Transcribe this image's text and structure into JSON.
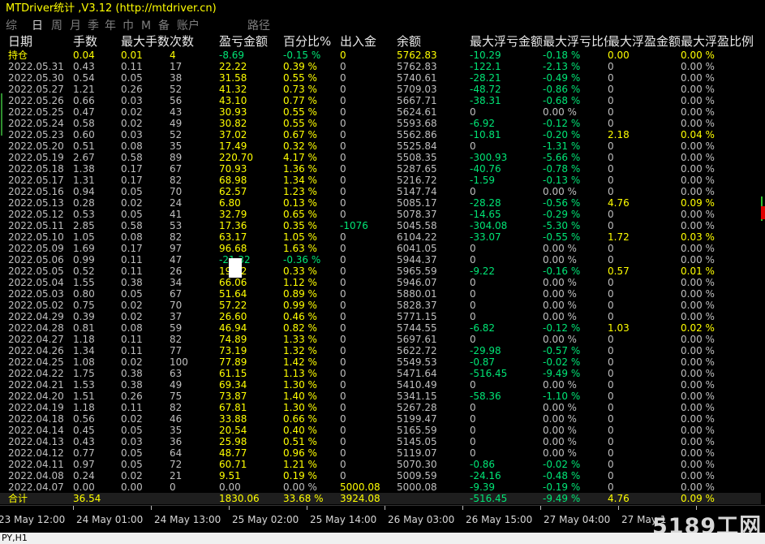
{
  "window": {
    "title": "MTDriver统计 ,V3.12 (http://mtdriver.cn)"
  },
  "tabs": {
    "items": [
      {
        "label": "综"
      },
      {
        "label": "日"
      },
      {
        "label": "周"
      },
      {
        "label": "月"
      },
      {
        "label": "季"
      },
      {
        "label": "年"
      },
      {
        "label": "巾"
      },
      {
        "label": "M"
      },
      {
        "label": "备"
      },
      {
        "label": "账户"
      }
    ],
    "path": "路径"
  },
  "table": {
    "headers": [
      "日期",
      "手数",
      "最大手数",
      "次数",
      "盈亏金额",
      "百分比%",
      "出入金",
      "余额",
      "最大浮亏金额",
      "最大浮亏比例",
      "最大浮盈金额",
      "最大浮盈比例"
    ],
    "holding": [
      "持仓",
      "0.04",
      "0.01",
      "4",
      "-8.69",
      "-0.15 %",
      "0",
      "5762.83",
      "-10.29",
      "-0.18 %",
      "0.00",
      "0.00 %"
    ],
    "rows": [
      [
        "2022.05.31",
        "0.43",
        "0.11",
        "17",
        "22.22",
        "0.39 %",
        "0",
        "5762.83",
        "-122.1",
        "-2.13 %",
        "0",
        "0.00 %"
      ],
      [
        "2022.05.30",
        "0.54",
        "0.05",
        "38",
        "31.58",
        "0.55 %",
        "0",
        "5740.61",
        "-28.21",
        "-0.49 %",
        "0",
        "0.00 %"
      ],
      [
        "2022.05.27",
        "1.21",
        "0.26",
        "52",
        "41.32",
        "0.73 %",
        "0",
        "5709.03",
        "-48.72",
        "-0.86 %",
        "0",
        "0.00 %"
      ],
      [
        "2022.05.26",
        "0.66",
        "0.03",
        "56",
        "43.10",
        "0.77 %",
        "0",
        "5667.71",
        "-38.31",
        "-0.68 %",
        "0",
        "0.00 %"
      ],
      [
        "2022.05.25",
        "0.47",
        "0.02",
        "43",
        "30.93",
        "0.55 %",
        "0",
        "5624.61",
        "0",
        "0.00 %",
        "0",
        "0.00 %"
      ],
      [
        "2022.05.24",
        "0.58",
        "0.02",
        "49",
        "30.82",
        "0.55 %",
        "0",
        "5593.68",
        "-6.92",
        "-0.12 %",
        "0",
        "0.00 %"
      ],
      [
        "2022.05.23",
        "0.60",
        "0.03",
        "52",
        "37.02",
        "0.67 %",
        "0",
        "5562.86",
        "-10.81",
        "-0.20 %",
        "2.18",
        "0.04 %"
      ],
      [
        "2022.05.20",
        "0.51",
        "0.08",
        "35",
        "17.49",
        "0.32 %",
        "0",
        "5525.84",
        "0",
        "-1.31 %",
        "0",
        "0.00 %"
      ],
      [
        "2022.05.19",
        "2.67",
        "0.58",
        "89",
        "220.70",
        "4.17 %",
        "0",
        "5508.35",
        "-300.93",
        "-5.66 %",
        "0",
        "0.00 %"
      ],
      [
        "2022.05.18",
        "1.38",
        "0.17",
        "67",
        "70.93",
        "1.36 %",
        "0",
        "5287.65",
        "-40.76",
        "-0.78 %",
        "0",
        "0.00 %"
      ],
      [
        "2022.05.17",
        "1.31",
        "0.17",
        "82",
        "68.98",
        "1.34 %",
        "0",
        "5216.72",
        "-1.59",
        "-0.13 %",
        "0",
        "0.00 %"
      ],
      [
        "2022.05.16",
        "0.94",
        "0.05",
        "70",
        "62.57",
        "1.23 %",
        "0",
        "5147.74",
        "0",
        "0.00 %",
        "0",
        "0.00 %"
      ],
      [
        "2022.05.13",
        "0.28",
        "0.02",
        "24",
        "6.80",
        "0.13 %",
        "0",
        "5085.17",
        "-28.28",
        "-0.56 %",
        "4.76",
        "0.09 %"
      ],
      [
        "2022.05.12",
        "0.53",
        "0.05",
        "41",
        "32.79",
        "0.65 %",
        "0",
        "5078.37",
        "-14.65",
        "-0.29 %",
        "0",
        "0.00 %"
      ],
      [
        "2022.05.11",
        "2.85",
        "0.58",
        "53",
        "17.36",
        "0.35 %",
        "-1076",
        "5045.58",
        "-304.08",
        "-5.30 %",
        "0",
        "0.00 %"
      ],
      [
        "2022.05.10",
        "1.05",
        "0.08",
        "82",
        "63.17",
        "1.05 %",
        "0",
        "6104.22",
        "-33.07",
        "-0.55 %",
        "1.72",
        "0.03 %"
      ],
      [
        "2022.05.09",
        "1.69",
        "0.17",
        "97",
        "96.68",
        "1.63 %",
        "0",
        "6041.05",
        "0",
        "0.00 %",
        "0",
        "0.00 %"
      ],
      [
        "2022.05.06",
        "0.99",
        "0.11",
        "47",
        "-21.32",
        "-0.36 %",
        "0",
        "5944.37",
        "0",
        "0.00 %",
        "0",
        "0.00 %"
      ],
      [
        "2022.05.05",
        "0.52",
        "0.11",
        "26",
        "19.32",
        "0.33 %",
        "0",
        "5965.59",
        "-9.22",
        "-0.16 %",
        "0.57",
        "0.01 %"
      ],
      [
        "2022.05.04",
        "1.55",
        "0.38",
        "34",
        "66.06",
        "1.12 %",
        "0",
        "5946.07",
        "0",
        "0.00 %",
        "0",
        "0.00 %"
      ],
      [
        "2022.05.03",
        "0.80",
        "0.05",
        "67",
        "51.64",
        "0.89 %",
        "0",
        "5880.01",
        "0",
        "0.00 %",
        "0",
        "0.00 %"
      ],
      [
        "2022.05.02",
        "0.75",
        "0.02",
        "70",
        "57.22",
        "0.99 %",
        "0",
        "5828.37",
        "0",
        "0.00 %",
        "0",
        "0.00 %"
      ],
      [
        "2022.04.29",
        "0.39",
        "0.02",
        "37",
        "26.60",
        "0.46 %",
        "0",
        "5771.15",
        "0",
        "0.00 %",
        "0",
        "0.00 %"
      ],
      [
        "2022.04.28",
        "0.81",
        "0.08",
        "59",
        "46.94",
        "0.82 %",
        "0",
        "5744.55",
        "-6.82",
        "-0.12 %",
        "1.03",
        "0.02 %"
      ],
      [
        "2022.04.27",
        "1.18",
        "0.11",
        "82",
        "74.89",
        "1.33 %",
        "0",
        "5697.61",
        "0",
        "0.00 %",
        "0",
        "0.00 %"
      ],
      [
        "2022.04.26",
        "1.34",
        "0.11",
        "77",
        "73.19",
        "1.32 %",
        "0",
        "5622.72",
        "-29.98",
        "-0.57 %",
        "0",
        "0.00 %"
      ],
      [
        "2022.04.25",
        "1.08",
        "0.02",
        "100",
        "77.89",
        "1.42 %",
        "0",
        "5549.53",
        "-0.87",
        "-0.02 %",
        "0",
        "0.00 %"
      ],
      [
        "2022.04.22",
        "1.75",
        "0.38",
        "63",
        "61.15",
        "1.13 %",
        "0",
        "5471.64",
        "-516.45",
        "-9.49 %",
        "0",
        "0.00 %"
      ],
      [
        "2022.04.21",
        "1.53",
        "0.38",
        "49",
        "69.34",
        "1.30 %",
        "0",
        "5410.49",
        "0",
        "0.00 %",
        "0",
        "0.00 %"
      ],
      [
        "2022.04.20",
        "1.51",
        "0.26",
        "75",
        "73.87",
        "1.40 %",
        "0",
        "5341.15",
        "-58.36",
        "-1.10 %",
        "0",
        "0.00 %"
      ],
      [
        "2022.04.19",
        "1.18",
        "0.11",
        "82",
        "67.81",
        "1.30 %",
        "0",
        "5267.28",
        "0",
        "0.00 %",
        "0",
        "0.00 %"
      ],
      [
        "2022.04.18",
        "0.56",
        "0.02",
        "46",
        "33.88",
        "0.66 %",
        "0",
        "5199.47",
        "0",
        "0.00 %",
        "0",
        "0.00 %"
      ],
      [
        "2022.04.14",
        "0.45",
        "0.05",
        "35",
        "20.54",
        "0.40 %",
        "0",
        "5165.59",
        "0",
        "0.00 %",
        "0",
        "0.00 %"
      ],
      [
        "2022.04.13",
        "0.43",
        "0.03",
        "36",
        "25.98",
        "0.51 %",
        "0",
        "5145.05",
        "0",
        "0.00 %",
        "0",
        "0.00 %"
      ],
      [
        "2022.04.12",
        "0.77",
        "0.05",
        "64",
        "48.77",
        "0.96 %",
        "0",
        "5119.07",
        "0",
        "0.00 %",
        "0",
        "0.00 %"
      ],
      [
        "2022.04.11",
        "0.97",
        "0.05",
        "72",
        "60.71",
        "1.21 %",
        "0",
        "5070.30",
        "-0.86",
        "-0.02 %",
        "0",
        "0.00 %"
      ],
      [
        "2022.04.08",
        "0.24",
        "0.02",
        "21",
        "9.51",
        "0.19 %",
        "0",
        "5009.59",
        "-24.16",
        "-0.48 %",
        "0",
        "0.00 %"
      ],
      [
        "2022.04.07",
        "0.00",
        "0.00",
        "0",
        "0.00",
        "0.00 %",
        "5000.08",
        "5000.08",
        "-9.39",
        "-0.19 %",
        "0",
        "0.00 %"
      ]
    ],
    "total": [
      "合计",
      "36.54",
      "",
      "",
      "1830.06",
      "33.68 %",
      "3924.08",
      "",
      "-516.45",
      "-9.49 %",
      "4.76",
      "0.09 %"
    ]
  },
  "time_axis": {
    "labels": [
      "23 May 12:00",
      "24 May 01:00",
      "24 May 13:00",
      "25 May 02:00",
      "25 May 14:00",
      "26 May 03:00",
      "26 May 15:00",
      "27 May 04:00",
      "27 May 1"
    ]
  },
  "status_bar": {
    "text": "PY,H1"
  },
  "watermark": {
    "text": "5189工网"
  },
  "colors": {
    "positive": "#ffff00",
    "negative": "#00e676",
    "normal": "#bfbfbf",
    "header": "#e8e8e8"
  }
}
